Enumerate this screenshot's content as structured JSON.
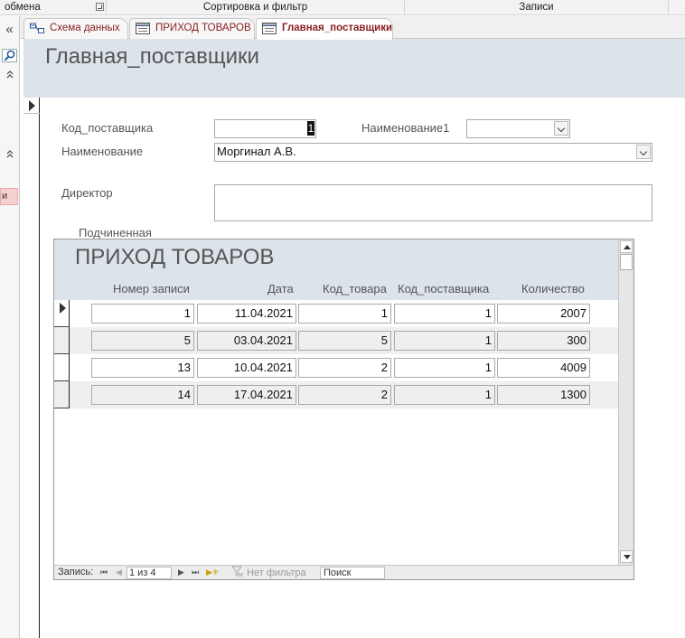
{
  "ribbon": {
    "groups": [
      "обмена",
      "Сортировка и фильтр",
      "Записи"
    ]
  },
  "nav": {
    "collapse_icon": "«",
    "up_icon_1": "⌃",
    "up_icon_2": "⌃",
    "highlight_text": "и"
  },
  "tabs": [
    {
      "label": "Схема данных",
      "icon": "relationships-icon"
    },
    {
      "label": "ПРИХОД ТОВАРОВ",
      "icon": "form-icon"
    },
    {
      "label": "Главная_поставщики",
      "icon": "form-icon",
      "active": true
    }
  ],
  "form": {
    "title": "Главная_поставщики",
    "fields": {
      "kod_label": "Код_поставщика",
      "kod_value": "1",
      "name1_label": "Наименование1",
      "name1_value": "",
      "name_label": "Наименование",
      "name_value": "Моргинал А.В.",
      "director_label": "Директор",
      "director_value": ""
    },
    "subform_label": "Подчиненная"
  },
  "subform": {
    "title": "ПРИХОД ТОВАРОВ",
    "columns": [
      "Номер записи",
      "Дата",
      "Код_товара",
      "Код_поставщика",
      "Количество"
    ],
    "rows": [
      [
        "1",
        "11.04.2021",
        "1",
        "1",
        "2007"
      ],
      [
        "5",
        "03.04.2021",
        "5",
        "1",
        "300"
      ],
      [
        "13",
        "10.04.2021",
        "2",
        "1",
        "4009"
      ],
      [
        "14",
        "17.04.2021",
        "2",
        "1",
        "1300"
      ]
    ],
    "navigator": {
      "record_label": "Запись:",
      "first": "⏮",
      "prev": "◀",
      "position": "1 из 4",
      "next": "▶",
      "last": "⏭",
      "new": "▶✳",
      "filter": "Нет фильтра",
      "search": "Поиск"
    }
  },
  "colors": {
    "header_bg": "#dce3ea",
    "tab_text": "#8a1e1e",
    "alt_row": "#efefef"
  }
}
